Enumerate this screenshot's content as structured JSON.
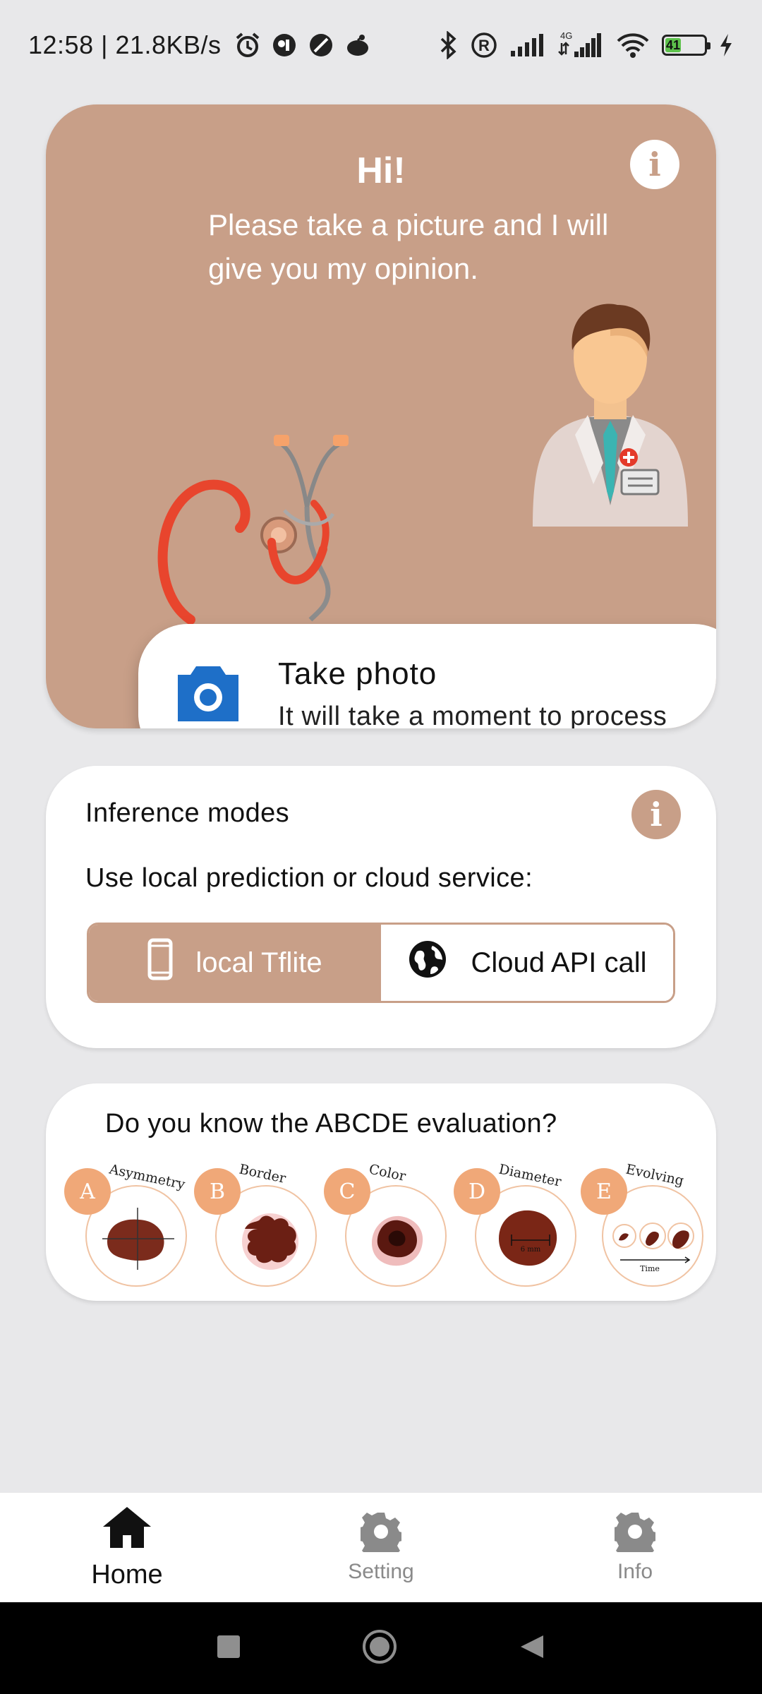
{
  "status_bar": {
    "time_speed": "12:58 | 21.8KB/s",
    "network_label": "4G",
    "battery_level": "41",
    "battery_fraction": 0.41,
    "icons_left": [
      "alarm-icon",
      "app-icon-1",
      "app-icon-2",
      "app-icon-3"
    ],
    "icons_right": [
      "bluetooth-icon",
      "registered-icon",
      "signal-icon",
      "signal-4g-icon",
      "wifi-icon",
      "battery-icon",
      "charging-icon"
    ]
  },
  "hero": {
    "title": "Hi!",
    "subtitle": "Please take a picture and I will give you my opinion.",
    "info_icon": "info-icon",
    "background_color": "#c89f88",
    "photo_button": {
      "title": "Take photo",
      "description": "It will take a moment to process",
      "icon": "camera-icon",
      "icon_color": "#1e6fc8"
    }
  },
  "inference": {
    "title": "Inference modes",
    "description": "Use local prediction or cloud service:",
    "info_icon": "info-icon",
    "options": [
      {
        "label": "local Tflite",
        "icon": "phone-icon",
        "selected": true
      },
      {
        "label": "Cloud API call",
        "icon": "globe-icon",
        "selected": false
      }
    ]
  },
  "abcde": {
    "title": "Do you know the ABCDE evaluation?",
    "items": [
      {
        "letter": "A",
        "word": "Asymmetry"
      },
      {
        "letter": "B",
        "word": "Border"
      },
      {
        "letter": "C",
        "word": "Color"
      },
      {
        "letter": "D",
        "word": "Diameter",
        "inner_label": "6 mm"
      },
      {
        "letter": "E",
        "word": "Evolving",
        "inner_label": "Time"
      }
    ]
  },
  "bottom_nav": {
    "items": [
      {
        "label": "Home",
        "icon": "home-icon",
        "active": true
      },
      {
        "label": "Setting",
        "icon": "gear-icon",
        "active": false
      },
      {
        "label": "Info",
        "icon": "gear-icon",
        "active": false
      }
    ]
  },
  "system_nav": [
    "recents-icon",
    "home-circle-icon",
    "back-icon"
  ]
}
